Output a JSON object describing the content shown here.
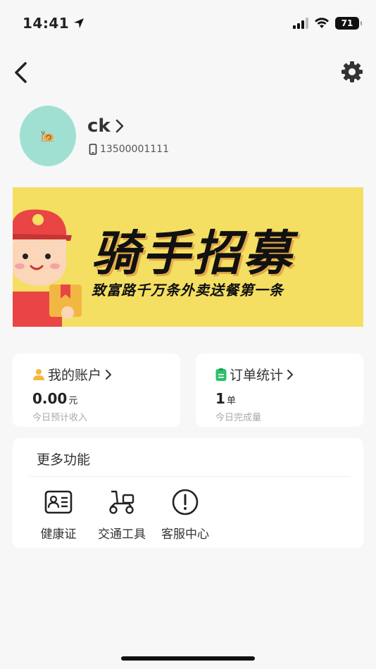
{
  "status_bar": {
    "time": "14:41",
    "battery": "71"
  },
  "profile": {
    "username": "ck",
    "phone": "13500001111"
  },
  "banner": {
    "title": "骑手招募",
    "subtitle": "致富路千万条外卖送餐第一条"
  },
  "account": {
    "title": "我的账户",
    "value": "0.00",
    "unit": "元",
    "desc": "今日预计收入"
  },
  "orders": {
    "title": "订单统计",
    "value": "1",
    "unit": "单",
    "desc": "今日完成量"
  },
  "more": {
    "title": "更多功能",
    "items": [
      {
        "label": "健康证",
        "icon": "id-card-icon"
      },
      {
        "label": "交通工具",
        "icon": "scooter-icon"
      },
      {
        "label": "客服中心",
        "icon": "alert-circle-icon"
      }
    ]
  },
  "colors": {
    "avatar_bg": "#9fe0d3",
    "banner_bg": "#f4df63",
    "account_icon": "#f5b73b",
    "orders_icon": "#2ec06b"
  }
}
